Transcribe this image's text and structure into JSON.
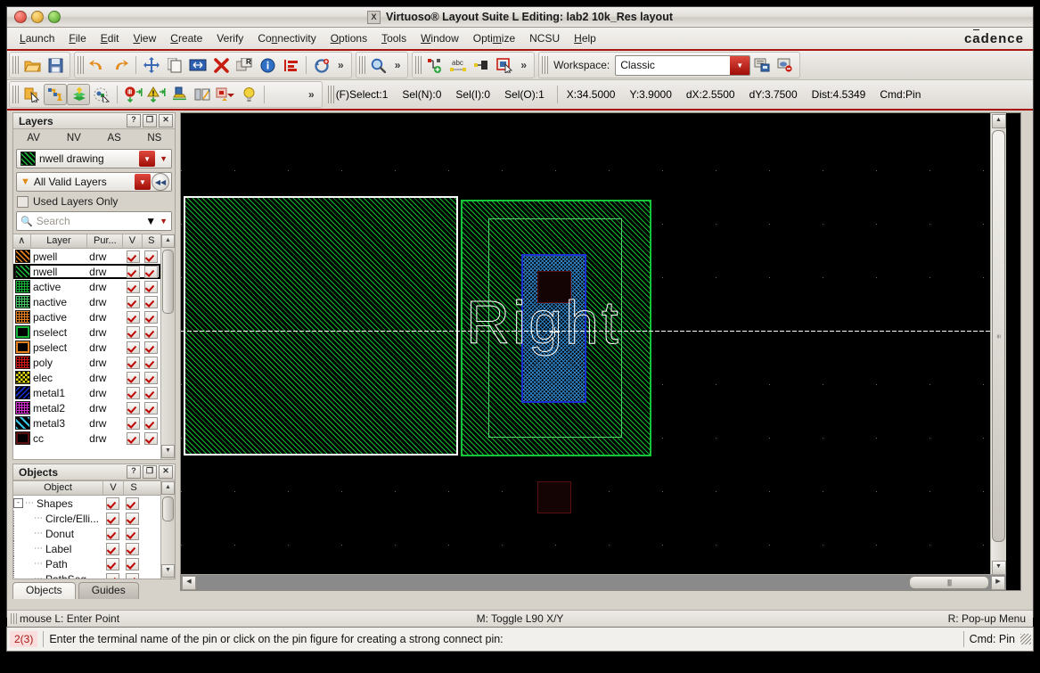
{
  "window": {
    "title": "Virtuoso® Layout Suite L Editing: lab2 10k_Res layout",
    "app_icon": "X",
    "brand": "cadence"
  },
  "menubar": {
    "items": [
      {
        "label": "Launch",
        "mnemonic": "L"
      },
      {
        "label": "File",
        "mnemonic": "F"
      },
      {
        "label": "Edit",
        "mnemonic": "E"
      },
      {
        "label": "View",
        "mnemonic": "V"
      },
      {
        "label": "Create",
        "mnemonic": "C"
      },
      {
        "label": "Verify",
        "mnemonic": ""
      },
      {
        "label": "Connectivity",
        "mnemonic": "n"
      },
      {
        "label": "Options",
        "mnemonic": "O"
      },
      {
        "label": "Tools",
        "mnemonic": "T"
      },
      {
        "label": "Window",
        "mnemonic": "W"
      },
      {
        "label": "Optimize",
        "mnemonic": "m"
      },
      {
        "label": "NCSU",
        "mnemonic": ""
      },
      {
        "label": "Help",
        "mnemonic": "H"
      }
    ]
  },
  "toolbar": {
    "workspace_label": "Workspace:",
    "workspace_value": "Classic",
    "overflow": "»",
    "row1_icons": [
      "open-folder-icon",
      "save-disk-icon",
      "undo-icon",
      "redo-icon",
      "move-icon",
      "copy-icon",
      "stretch-icon",
      "delete-icon",
      "rotate-icon",
      "properties-info-icon",
      "align-icon",
      "undo-group-icon"
    ],
    "row2_icons": [
      "select-object-icon",
      "flight-line-icon",
      "layer-stack-icon",
      "partial-select-icon",
      "stop-edit-icon",
      "warning-edit-icon",
      "pin-edit-icon",
      "split-icon",
      "instance-icon",
      "bulb-icon"
    ],
    "row1_extra_icons": [
      "zoom-icon",
      "net-add-icon",
      "label-abc-icon",
      "pin-shape-icon",
      "box-cursor-icon"
    ],
    "right_icons": [
      "save-workspace-icon",
      "delete-workspace-icon"
    ]
  },
  "statusbar_coords": {
    "select": "(F)Select:1",
    "sel_n": "Sel(N):0",
    "sel_i": "Sel(I):0",
    "sel_o": "Sel(O):1",
    "x": "X:34.5000",
    "y": "Y:3.9000",
    "dx": "dX:2.5500",
    "dy": "dY:3.7500",
    "dist": "Dist:4.5349",
    "cmd": "Cmd:Pin"
  },
  "layers_panel": {
    "title": "Layers",
    "header_buttons": [
      "?",
      "⊟",
      "✕"
    ],
    "av_nv_as_ns": [
      "AV",
      "NV",
      "AS",
      "NS"
    ],
    "current_layer": "nwell drawing",
    "filter_value": "All Valid Layers",
    "used_layers_only_label": "Used Layers Only",
    "used_layers_only_checked": false,
    "search_placeholder": "Search",
    "columns": [
      "Layer",
      "Pur...",
      "V",
      "S"
    ],
    "rows": [
      {
        "layer": "pwell",
        "purpose": "drw",
        "v": true,
        "s": true,
        "color": "#e8821e",
        "pattern": "diag"
      },
      {
        "layer": "nwell",
        "purpose": "drw",
        "v": true,
        "s": true,
        "color": "#17b53a",
        "pattern": "diag",
        "selected": true
      },
      {
        "layer": "active",
        "purpose": "drw",
        "v": true,
        "s": true,
        "color": "#17b53a",
        "pattern": "dot"
      },
      {
        "layer": "nactive",
        "purpose": "drw",
        "v": true,
        "s": true,
        "color": "#47c96a",
        "pattern": "dot"
      },
      {
        "layer": "pactive",
        "purpose": "drw",
        "v": true,
        "s": true,
        "color": "#e8821e",
        "pattern": "dot"
      },
      {
        "layer": "nselect",
        "purpose": "drw",
        "v": true,
        "s": true,
        "color": "#17b53a",
        "pattern": "solid-outline"
      },
      {
        "layer": "pselect",
        "purpose": "drw",
        "v": true,
        "s": true,
        "color": "#e8821e",
        "pattern": "solid-outline"
      },
      {
        "layer": "poly",
        "purpose": "drw",
        "v": true,
        "s": true,
        "color": "#d41818",
        "pattern": "dot"
      },
      {
        "layer": "elec",
        "purpose": "drw",
        "v": true,
        "s": true,
        "color": "#e8e017",
        "pattern": "check"
      },
      {
        "layer": "metal1",
        "purpose": "drw",
        "v": true,
        "s": true,
        "color": "#1a2fd6",
        "pattern": "backdiag"
      },
      {
        "layer": "metal2",
        "purpose": "drw",
        "v": true,
        "s": true,
        "color": "#d62fd6",
        "pattern": "dot"
      },
      {
        "layer": "metal3",
        "purpose": "drw",
        "v": true,
        "s": true,
        "color": "#37c8e8",
        "pattern": "fwddiag"
      },
      {
        "layer": "cc",
        "purpose": "drw",
        "v": true,
        "s": true,
        "color": "#5a1010",
        "pattern": "solid-outline"
      }
    ]
  },
  "objects_panel": {
    "title": "Objects",
    "header_buttons": [
      "?",
      "⊟",
      "✕"
    ],
    "columns": [
      "Object",
      "V",
      "S"
    ],
    "rows": [
      {
        "label": "Shapes",
        "depth": 0,
        "expander": "-",
        "v": true,
        "s": true
      },
      {
        "label": "Circle/Elli...",
        "depth": 1,
        "expander": "",
        "v": true,
        "s": true
      },
      {
        "label": "Donut",
        "depth": 1,
        "expander": "",
        "v": true,
        "s": true
      },
      {
        "label": "Label",
        "depth": 1,
        "expander": "",
        "v": true,
        "s": true
      },
      {
        "label": "Path",
        "depth": 1,
        "expander": "",
        "v": true,
        "s": true
      },
      {
        "label": "PathSeg",
        "depth": 1,
        "expander": "",
        "v": true,
        "s": true
      }
    ],
    "tabs": [
      {
        "label": "Objects",
        "active": true
      },
      {
        "label": "Guides",
        "active": false
      }
    ]
  },
  "canvas": {
    "label_text": "Right",
    "shapes": [
      {
        "name": "nwell-region-left",
        "layer": "nwell",
        "selected": true
      },
      {
        "name": "nwell-region-right",
        "layer": "nwell",
        "selected": false
      },
      {
        "name": "nselect-ring",
        "layer": "nselect"
      },
      {
        "name": "metal1-pin-box",
        "layer": "metal1"
      },
      {
        "name": "cc-contact-top",
        "layer": "cc"
      },
      {
        "name": "cc-contact-bottom",
        "layer": "cc"
      }
    ]
  },
  "mousebar": {
    "left": "mouse L: Enter Point",
    "middle": "M: Toggle L90 X/Y",
    "right": "R: Pop-up Menu"
  },
  "cmdbar": {
    "count": "2(3)",
    "message": "Enter the terminal name of the pin or click on the pin figure for creating a strong connect pin:",
    "cmd": "Cmd: Pin"
  }
}
